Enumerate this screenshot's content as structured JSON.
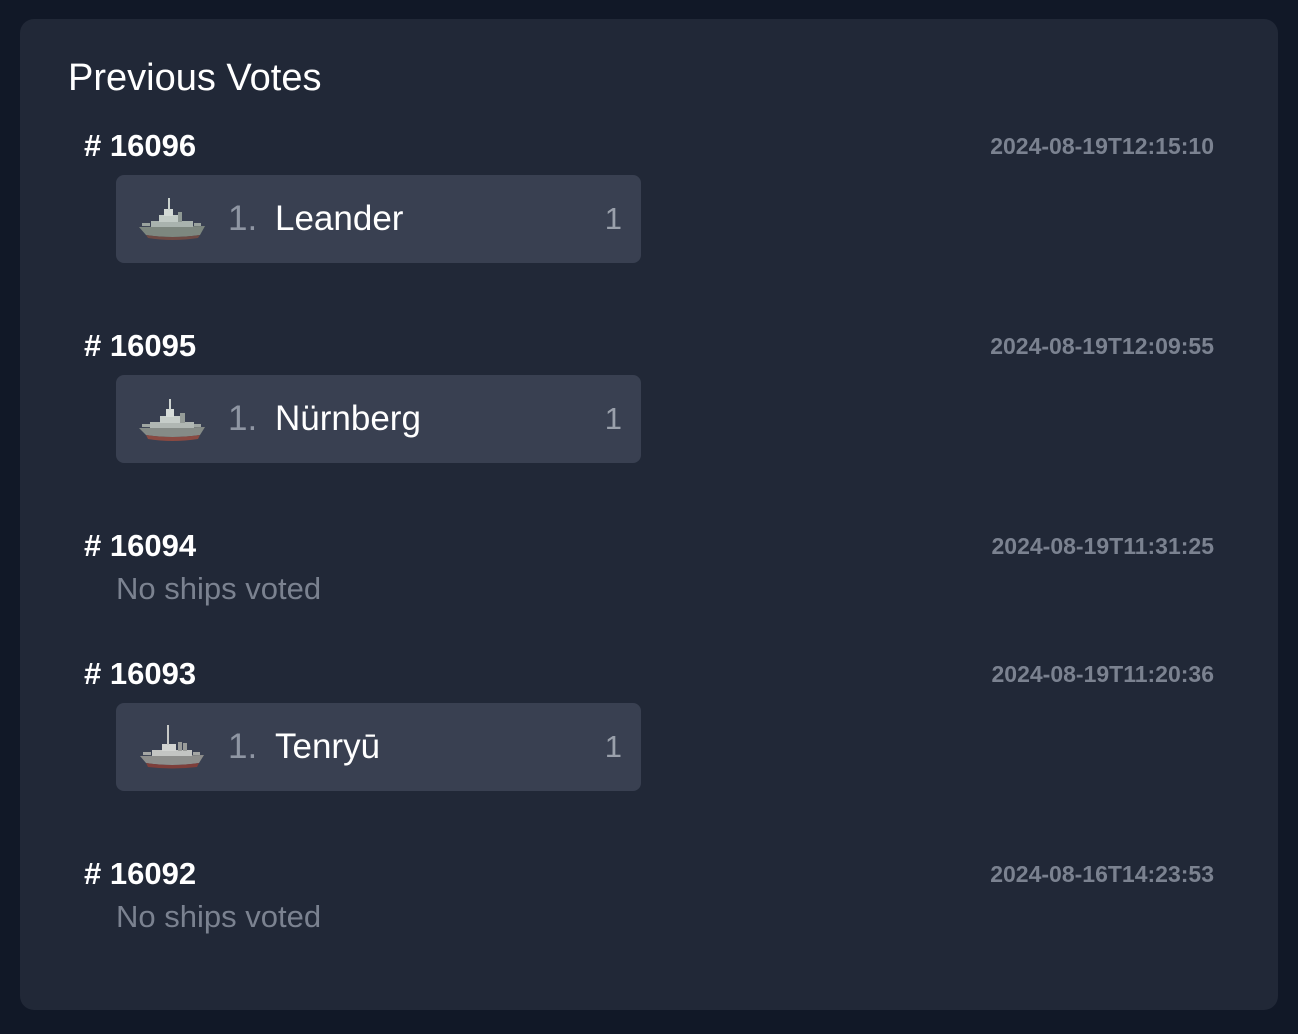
{
  "panel": {
    "title": "Previous Votes"
  },
  "votes": [
    {
      "id": "# 16096",
      "timestamp": "2024-08-19T12:15:10",
      "ship": {
        "rank": "1.",
        "name": "Leander",
        "count": "1",
        "icon": "cruiser-ship-icon"
      }
    },
    {
      "id": "# 16095",
      "timestamp": "2024-08-19T12:09:55",
      "ship": {
        "rank": "1.",
        "name": "Nürnberg",
        "count": "1",
        "icon": "cruiser-ship-icon"
      }
    },
    {
      "id": "# 16094",
      "timestamp": "2024-08-19T11:31:25",
      "empty_text": "No ships voted"
    },
    {
      "id": "# 16093",
      "timestamp": "2024-08-19T11:20:36",
      "ship": {
        "rank": "1.",
        "name": "Tenryū",
        "count": "1",
        "icon": "cruiser-ship-icon"
      }
    },
    {
      "id": "# 16092",
      "timestamp": "2024-08-16T14:23:53",
      "empty_text": "No ships voted"
    }
  ],
  "colors": {
    "background": "#111827",
    "panel": "#212837",
    "card": "#394051",
    "muted_text": "#7b8290"
  }
}
